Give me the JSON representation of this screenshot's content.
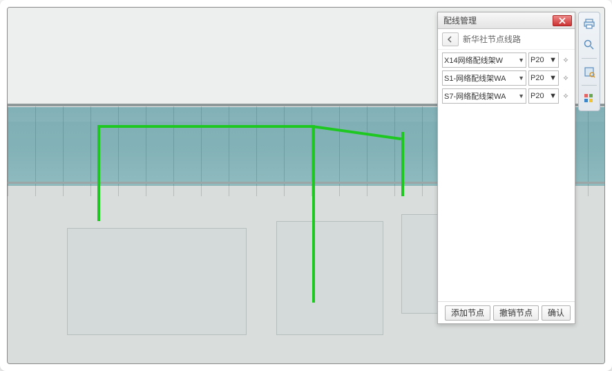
{
  "panel": {
    "title": "配线管理",
    "breadcrumb": "新华社节点线路",
    "rows": [
      {
        "node": "X14网络配线架W",
        "port": "P20"
      },
      {
        "node": "S1-网络配线架WA",
        "port": "P20"
      },
      {
        "node": "S7-网络配线架WA",
        "port": "P20"
      }
    ],
    "buttons": {
      "add": "添加节点",
      "undo": "撤销节点",
      "confirm": "确认"
    }
  },
  "toolbar": {
    "icons": [
      "print-icon",
      "search-icon",
      "locate-icon",
      "apps-icon"
    ]
  }
}
